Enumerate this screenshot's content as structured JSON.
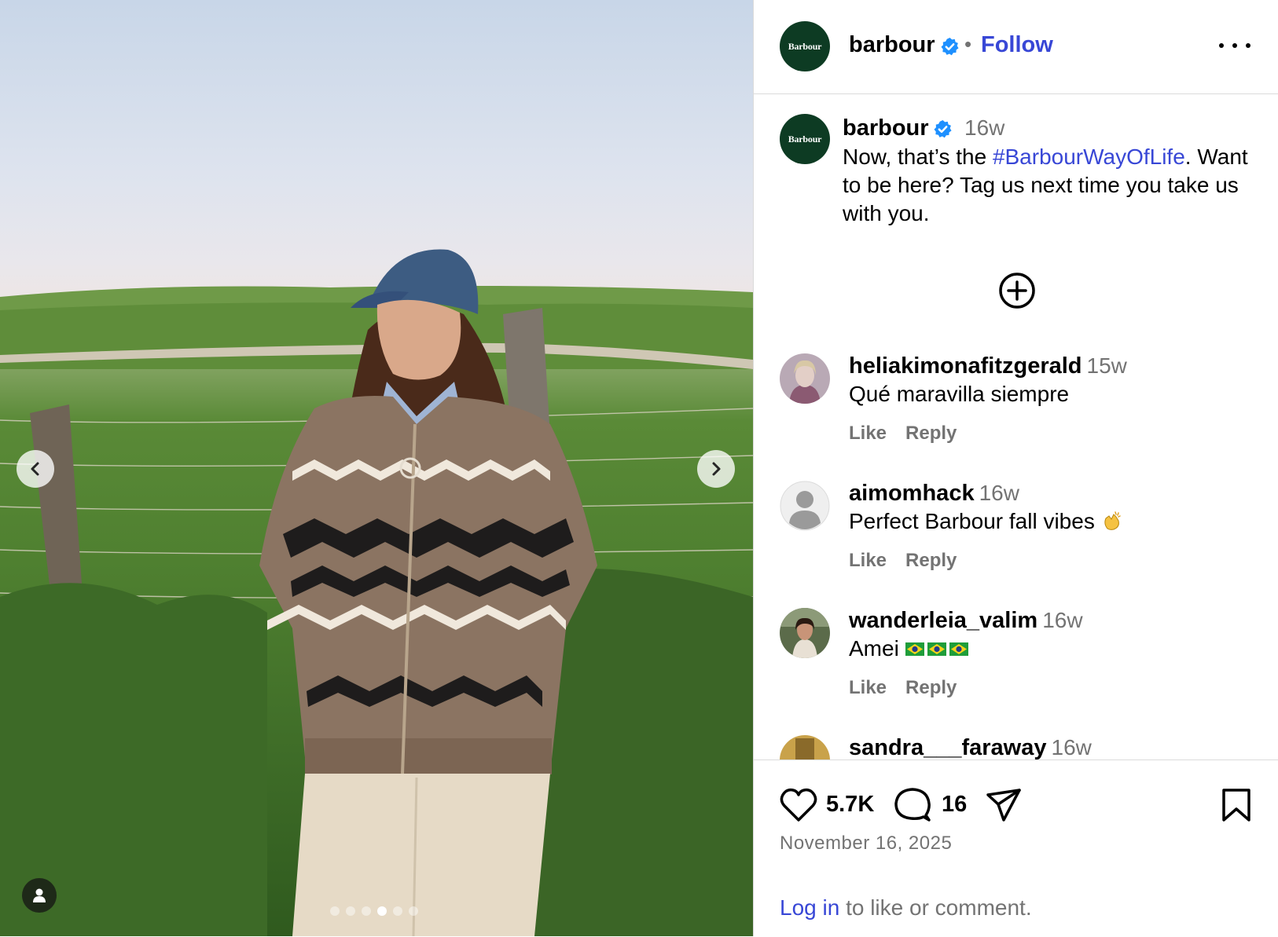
{
  "post": {
    "username": "barbour",
    "avatar_text": "Barbour",
    "follow_label": "Follow",
    "separator": "•",
    "brand_color": "#0d3b23",
    "link_color": "#3847d6",
    "verified_color": "#1e90ff"
  },
  "caption": {
    "username": "barbour",
    "time": "16w",
    "text_before": "Now, that’s the ",
    "hashtag": "#BarbourWayOfLife",
    "text_after": ". Want to be here? Tag us next time you take us with you."
  },
  "comments": [
    {
      "username": "heliakimonafitzgerald",
      "time": "15w",
      "text": "Qué maravilla siempre",
      "like": "Like",
      "reply": "Reply"
    },
    {
      "username": "aimomhack",
      "time": "16w",
      "text": "Perfect Barbour fall vibes",
      "like": "Like",
      "reply": "Reply"
    },
    {
      "username": "wanderleia_valim",
      "time": "16w",
      "text": "Amei",
      "like": "Like",
      "reply": "Reply"
    },
    {
      "username": "sandra___faraway",
      "time": "16w"
    }
  ],
  "actions": {
    "likes": "5.7K",
    "comments": "16",
    "date": "November 16, 2025"
  },
  "login": {
    "link": "Log in",
    "rest": " to like or comment."
  },
  "carousel": {
    "total": 6,
    "active_index": 3
  }
}
